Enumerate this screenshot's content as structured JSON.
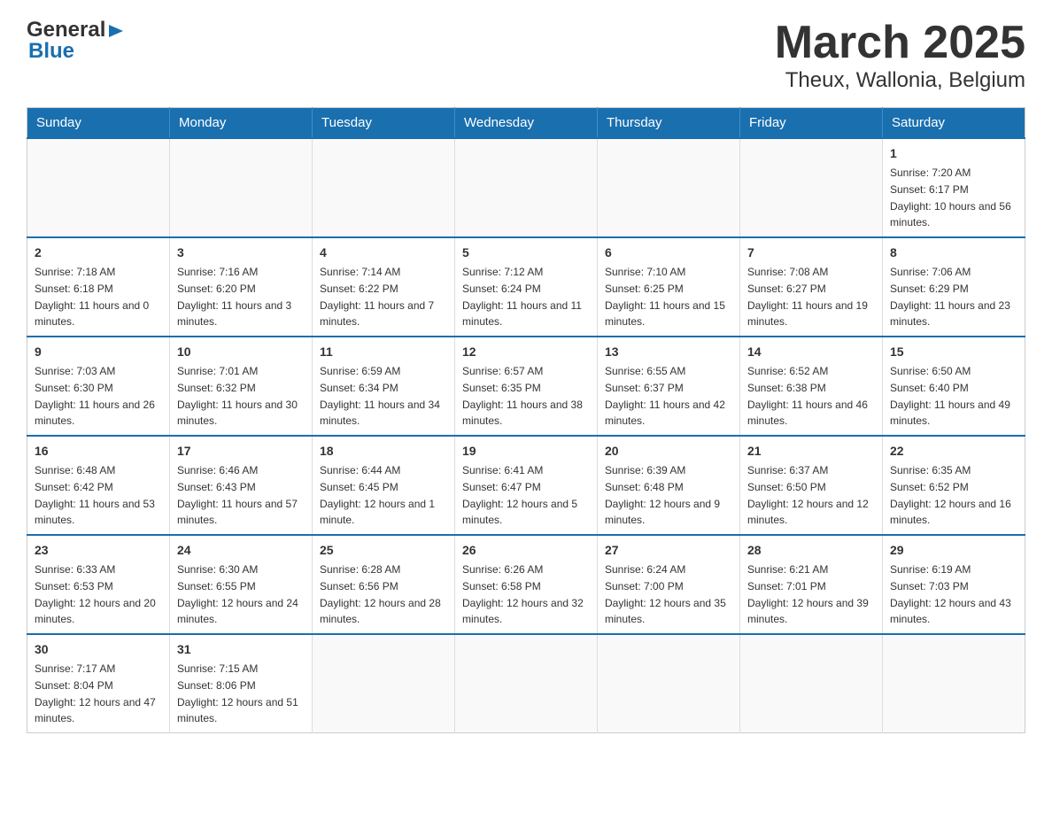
{
  "header": {
    "logo_general": "General",
    "logo_blue": "Blue",
    "title": "March 2025",
    "subtitle": "Theux, Wallonia, Belgium"
  },
  "calendar": {
    "days_of_week": [
      "Sunday",
      "Monday",
      "Tuesday",
      "Wednesday",
      "Thursday",
      "Friday",
      "Saturday"
    ],
    "weeks": [
      [
        {
          "day": "",
          "info": ""
        },
        {
          "day": "",
          "info": ""
        },
        {
          "day": "",
          "info": ""
        },
        {
          "day": "",
          "info": ""
        },
        {
          "day": "",
          "info": ""
        },
        {
          "day": "",
          "info": ""
        },
        {
          "day": "1",
          "info": "Sunrise: 7:20 AM\nSunset: 6:17 PM\nDaylight: 10 hours and 56 minutes."
        }
      ],
      [
        {
          "day": "2",
          "info": "Sunrise: 7:18 AM\nSunset: 6:18 PM\nDaylight: 11 hours and 0 minutes."
        },
        {
          "day": "3",
          "info": "Sunrise: 7:16 AM\nSunset: 6:20 PM\nDaylight: 11 hours and 3 minutes."
        },
        {
          "day": "4",
          "info": "Sunrise: 7:14 AM\nSunset: 6:22 PM\nDaylight: 11 hours and 7 minutes."
        },
        {
          "day": "5",
          "info": "Sunrise: 7:12 AM\nSunset: 6:24 PM\nDaylight: 11 hours and 11 minutes."
        },
        {
          "day": "6",
          "info": "Sunrise: 7:10 AM\nSunset: 6:25 PM\nDaylight: 11 hours and 15 minutes."
        },
        {
          "day": "7",
          "info": "Sunrise: 7:08 AM\nSunset: 6:27 PM\nDaylight: 11 hours and 19 minutes."
        },
        {
          "day": "8",
          "info": "Sunrise: 7:06 AM\nSunset: 6:29 PM\nDaylight: 11 hours and 23 minutes."
        }
      ],
      [
        {
          "day": "9",
          "info": "Sunrise: 7:03 AM\nSunset: 6:30 PM\nDaylight: 11 hours and 26 minutes."
        },
        {
          "day": "10",
          "info": "Sunrise: 7:01 AM\nSunset: 6:32 PM\nDaylight: 11 hours and 30 minutes."
        },
        {
          "day": "11",
          "info": "Sunrise: 6:59 AM\nSunset: 6:34 PM\nDaylight: 11 hours and 34 minutes."
        },
        {
          "day": "12",
          "info": "Sunrise: 6:57 AM\nSunset: 6:35 PM\nDaylight: 11 hours and 38 minutes."
        },
        {
          "day": "13",
          "info": "Sunrise: 6:55 AM\nSunset: 6:37 PM\nDaylight: 11 hours and 42 minutes."
        },
        {
          "day": "14",
          "info": "Sunrise: 6:52 AM\nSunset: 6:38 PM\nDaylight: 11 hours and 46 minutes."
        },
        {
          "day": "15",
          "info": "Sunrise: 6:50 AM\nSunset: 6:40 PM\nDaylight: 11 hours and 49 minutes."
        }
      ],
      [
        {
          "day": "16",
          "info": "Sunrise: 6:48 AM\nSunset: 6:42 PM\nDaylight: 11 hours and 53 minutes."
        },
        {
          "day": "17",
          "info": "Sunrise: 6:46 AM\nSunset: 6:43 PM\nDaylight: 11 hours and 57 minutes."
        },
        {
          "day": "18",
          "info": "Sunrise: 6:44 AM\nSunset: 6:45 PM\nDaylight: 12 hours and 1 minute."
        },
        {
          "day": "19",
          "info": "Sunrise: 6:41 AM\nSunset: 6:47 PM\nDaylight: 12 hours and 5 minutes."
        },
        {
          "day": "20",
          "info": "Sunrise: 6:39 AM\nSunset: 6:48 PM\nDaylight: 12 hours and 9 minutes."
        },
        {
          "day": "21",
          "info": "Sunrise: 6:37 AM\nSunset: 6:50 PM\nDaylight: 12 hours and 12 minutes."
        },
        {
          "day": "22",
          "info": "Sunrise: 6:35 AM\nSunset: 6:52 PM\nDaylight: 12 hours and 16 minutes."
        }
      ],
      [
        {
          "day": "23",
          "info": "Sunrise: 6:33 AM\nSunset: 6:53 PM\nDaylight: 12 hours and 20 minutes."
        },
        {
          "day": "24",
          "info": "Sunrise: 6:30 AM\nSunset: 6:55 PM\nDaylight: 12 hours and 24 minutes."
        },
        {
          "day": "25",
          "info": "Sunrise: 6:28 AM\nSunset: 6:56 PM\nDaylight: 12 hours and 28 minutes."
        },
        {
          "day": "26",
          "info": "Sunrise: 6:26 AM\nSunset: 6:58 PM\nDaylight: 12 hours and 32 minutes."
        },
        {
          "day": "27",
          "info": "Sunrise: 6:24 AM\nSunset: 7:00 PM\nDaylight: 12 hours and 35 minutes."
        },
        {
          "day": "28",
          "info": "Sunrise: 6:21 AM\nSunset: 7:01 PM\nDaylight: 12 hours and 39 minutes."
        },
        {
          "day": "29",
          "info": "Sunrise: 6:19 AM\nSunset: 7:03 PM\nDaylight: 12 hours and 43 minutes."
        }
      ],
      [
        {
          "day": "30",
          "info": "Sunrise: 7:17 AM\nSunset: 8:04 PM\nDaylight: 12 hours and 47 minutes."
        },
        {
          "day": "31",
          "info": "Sunrise: 7:15 AM\nSunset: 8:06 PM\nDaylight: 12 hours and 51 minutes."
        },
        {
          "day": "",
          "info": ""
        },
        {
          "day": "",
          "info": ""
        },
        {
          "day": "",
          "info": ""
        },
        {
          "day": "",
          "info": ""
        },
        {
          "day": "",
          "info": ""
        }
      ]
    ]
  }
}
